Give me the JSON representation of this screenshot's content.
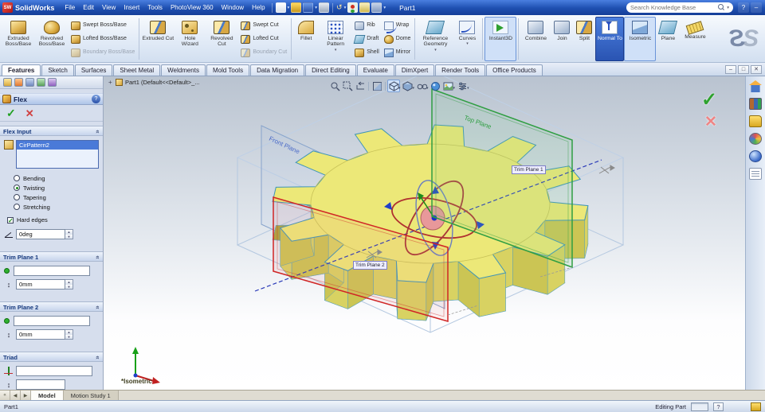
{
  "icons": {
    "check": "✓",
    "cancel": "✕",
    "question": "?",
    "dropdown": "▾",
    "spin_up": "▲",
    "spin_down": "▼",
    "chevron_collapse": "»",
    "nav_first": "«",
    "nav_prev": "◀",
    "nav_next": "▶",
    "minimize": "‒",
    "restore": "□",
    "close": "✕",
    "plus": "+",
    "updown": "↕",
    "undo": "↺",
    "logo_letter": "S",
    "logo_initials": "SW"
  },
  "titlebar": {
    "app_name": "SolidWorks",
    "menus": [
      "File",
      "Edit",
      "View",
      "Insert",
      "Tools",
      "PhotoView 360",
      "Window",
      "Help"
    ],
    "doc_title": "Part1",
    "search": {
      "placeholder": "Search Knowledge Base"
    }
  },
  "ribbon": {
    "extruded_boss": "Extruded Boss/Base",
    "revolved_boss": "Revolved Boss/Base",
    "swept_boss": "Swept Boss/Base",
    "lofted_boss": "Lofted Boss/Base",
    "boundary_boss": "Boundary Boss/Base",
    "extruded_cut": "Extruded Cut",
    "hole_wizard": "Hole Wizard",
    "revolved_cut": "Revolved Cut",
    "swept_cut": "Swept Cut",
    "lofted_cut": "Lofted Cut",
    "boundary_cut": "Boundary Cut",
    "fillet": "Fillet",
    "linear_pattern": "Linear Pattern",
    "rib": "Rib",
    "draft": "Draft",
    "shell": "Shell",
    "wrap": "Wrap",
    "dome": "Dome",
    "mirror": "Mirror",
    "reference_geometry": "Reference Geometry",
    "curves": "Curves",
    "instant3d": "Instant3D",
    "combine": "Combine",
    "join": "Join",
    "split": "Split",
    "normal_to": "Normal To",
    "isometric": "Isometric",
    "plane": "Plane",
    "measure": "Measure"
  },
  "command_tabs": [
    {
      "label": "Features",
      "active": true
    },
    {
      "label": "Sketch"
    },
    {
      "label": "Surfaces"
    },
    {
      "label": "Sheet Metal"
    },
    {
      "label": "Weldments"
    },
    {
      "label": "Mold Tools"
    },
    {
      "label": "Data Migration"
    },
    {
      "label": "Direct Editing"
    },
    {
      "label": "Evaluate"
    },
    {
      "label": "DimXpert"
    },
    {
      "label": "Render Tools"
    },
    {
      "label": "Office Products"
    }
  ],
  "pm": {
    "title": "Flex",
    "flex_input_label": "Flex Input",
    "selection": "CirPattern2",
    "radio_bending": "Bending",
    "radio_twisting": "Twisting",
    "radio_tapering": "Tapering",
    "radio_stretching": "Stretching",
    "hard_edges": "Hard edges",
    "angle_value": "0deg",
    "trim1_label": "Trim Plane 1",
    "trim1_value": "0mm",
    "trim2_label": "Trim Plane 2",
    "trim2_value": "0mm",
    "triad_label": "Triad"
  },
  "viewport": {
    "breadcrumb": "Part1  (Default<<Default>_...",
    "view_label": "*Isometric",
    "trim_plane_1": "Trim Plane 1",
    "trim_plane_2": "Trim Plane 2",
    "front_plane": "Front Plane",
    "top_plane": "Top Plane"
  },
  "bottom": {
    "tabs": [
      {
        "label": "Model",
        "active": true
      },
      {
        "label": "Motion Study 1"
      }
    ]
  },
  "statusbar": {
    "left": "Part1",
    "mode": "Editing Part"
  }
}
